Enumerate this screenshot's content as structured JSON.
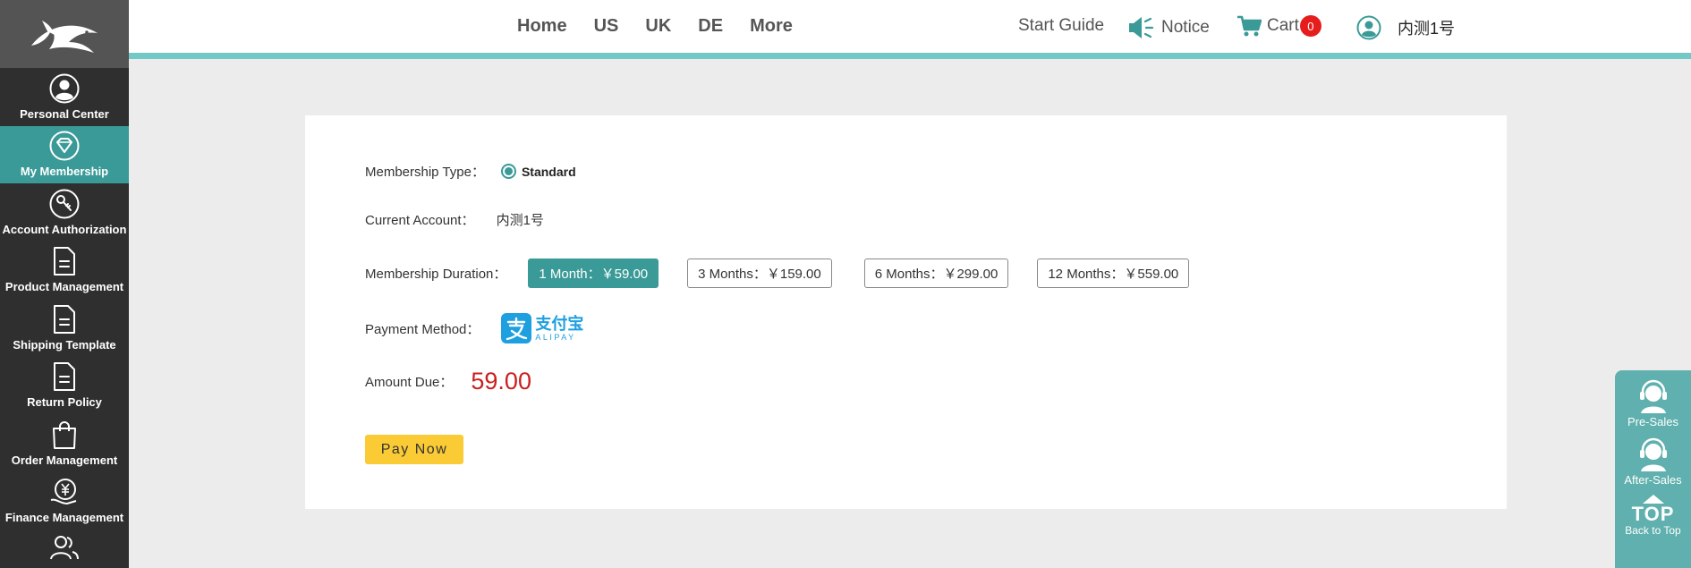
{
  "sidebar": {
    "items": [
      {
        "label": "Personal Center",
        "icon": "person-icon",
        "active": false
      },
      {
        "label": "My Membership",
        "icon": "diamond-icon",
        "active": true
      },
      {
        "label": "Account Authorization",
        "icon": "key-icon",
        "active": false
      },
      {
        "label": "Product Management",
        "icon": "document-icon",
        "active": false
      },
      {
        "label": "Shipping Template",
        "icon": "document-icon",
        "active": false
      },
      {
        "label": "Return Policy",
        "icon": "document-icon",
        "active": false
      },
      {
        "label": "Order Management",
        "icon": "shopping-bag-icon",
        "active": false
      },
      {
        "label": "Finance Management",
        "icon": "yuan-hand-icon",
        "active": false
      },
      {
        "label": "",
        "icon": "users-icon",
        "active": false
      }
    ]
  },
  "header": {
    "nav": [
      "Home",
      "US",
      "UK",
      "DE",
      "More"
    ],
    "start_guide": "Start Guide",
    "notice": "Notice",
    "cart": "Cart",
    "cart_count": "0",
    "username": "内测1号"
  },
  "form": {
    "membership_type_label": "Membership Type：",
    "membership_type_value": "Standard",
    "current_account_label": "Current Account：",
    "current_account_value": "内测1号",
    "duration_label": "Membership Duration：",
    "duration_options": [
      {
        "label": "1 Month：￥59.00",
        "selected": true
      },
      {
        "label": "3 Months：￥159.00",
        "selected": false
      },
      {
        "label": "6 Months：￥299.00",
        "selected": false
      },
      {
        "label": "12 Months：￥559.00",
        "selected": false
      }
    ],
    "payment_label": "Payment Method：",
    "alipay_text": "支付宝",
    "alipay_sub": "ALIPAY",
    "amount_label": "Amount Due：",
    "amount_value": "59.00",
    "pay_button": "Pay Now"
  },
  "float_panel": {
    "pre_sales": "Pre-Sales",
    "after_sales": "After-Sales",
    "top": "TOP",
    "back_to_top": "Back to Top"
  },
  "colors": {
    "accent": "#3a9a97",
    "top_border": "#72c9c7",
    "sidebar_bg": "#2f2f2f",
    "amount_red": "#cc1f1f",
    "pay_yellow": "#fbcb35",
    "badge_red": "#e61d1d",
    "alipay_blue": "#1d9fe0"
  }
}
